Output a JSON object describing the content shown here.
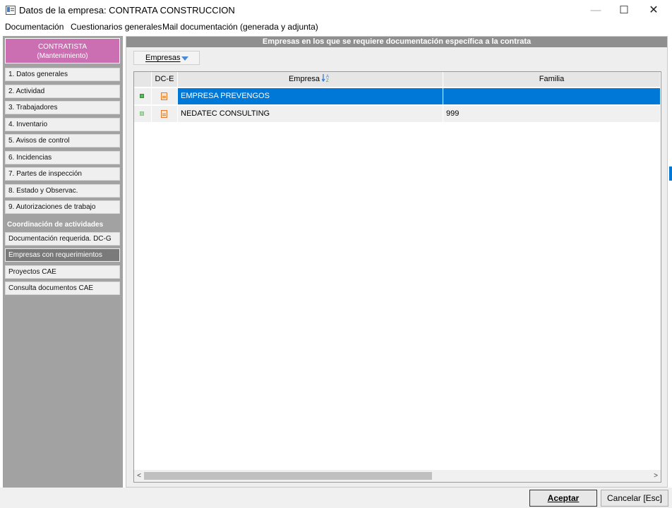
{
  "window": {
    "title": "Datos de la empresa: CONTRATA CONSTRUCCION",
    "minimize_label": "—",
    "maximize_label": "☐",
    "close_label": "✕"
  },
  "menubar": {
    "items": [
      "Documentación",
      "Cuestionarios generales",
      "Mail documentación (generada y adjunta)"
    ]
  },
  "sidebar": {
    "header_title": "CONTRATISTA",
    "header_subtitle": "(Mantenimiento)",
    "items": [
      "1. Datos generales",
      "2. Actividad",
      "3. Trabajadores",
      "4. Inventario",
      "5. Avisos de control",
      "6. Incidencias",
      "7. Partes de inspección",
      "8. Estado y Observac.",
      "9. Autorizaciones de trabajo"
    ],
    "section_title": "Coordinación de actividades",
    "coord_items": [
      "Documentación requerida. DC-G",
      "Empresas con requerimientos",
      "Proyectos CAE",
      "Consulta documentos CAE"
    ],
    "active_item": "Empresas con requerimientos"
  },
  "main": {
    "header": "Empresas en los que se requiere documentación específica a la contrata",
    "tab_label": "Empresas"
  },
  "grid": {
    "columns": [
      "",
      "DC-E",
      "Empresa",
      "Familia"
    ],
    "sort_icon": "sort-az-icon",
    "rows": [
      {
        "empresa": "EMPRESA PREVENGOS",
        "familia": "",
        "selected": true
      },
      {
        "empresa": "NEDATEC CONSULTING",
        "familia": "999",
        "selected": false
      }
    ]
  },
  "scroll": {
    "left_arrow": "<",
    "right_arrow": ">"
  },
  "buttons": {
    "accept": "Aceptar",
    "cancel": "Cancelar [Esc]"
  },
  "colors": {
    "accent": "#0078d7",
    "contratista": "#cc6eb2",
    "sidebar_bg": "#a2a2a2",
    "header_bg": "#8f8f8f"
  }
}
